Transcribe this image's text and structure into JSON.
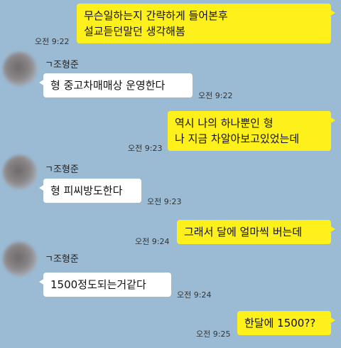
{
  "messages": [
    {
      "sender": "me",
      "lines": [
        "무슨일하는지 간략하게 들어본후",
        "설교듣던말던 생각해봄"
      ],
      "time": "오전 9:22"
    },
    {
      "sender": "them",
      "name": "ㄱ조형준",
      "lines": [
        "형 중고차매매상 운영한다"
      ],
      "time": "오전 9:22"
    },
    {
      "sender": "me",
      "lines": [
        "역시 나의 하나뿐인  형",
        "나 지금 차알아보고있었는데"
      ],
      "time": "오전 9:23"
    },
    {
      "sender": "them",
      "name": "ㄱ조형준",
      "lines": [
        "형 피씨방도한다"
      ],
      "time": "오전 9:23"
    },
    {
      "sender": "me",
      "lines": [
        "그래서 달에 얼마씩 버는데"
      ],
      "time": "오전 9:24"
    },
    {
      "sender": "them",
      "name": "ㄱ조형준",
      "lines": [
        "1500정도되는거같다"
      ],
      "time": "오전 9:24"
    },
    {
      "sender": "me",
      "lines": [
        "한달에 1500??"
      ],
      "time": "오전 9:25"
    }
  ],
  "colors": {
    "background": "#9bbbd4",
    "my_bubble": "#fef01b",
    "their_bubble": "#ffffff"
  },
  "icons": {
    "avatar": "blurred-profile-avatar"
  }
}
